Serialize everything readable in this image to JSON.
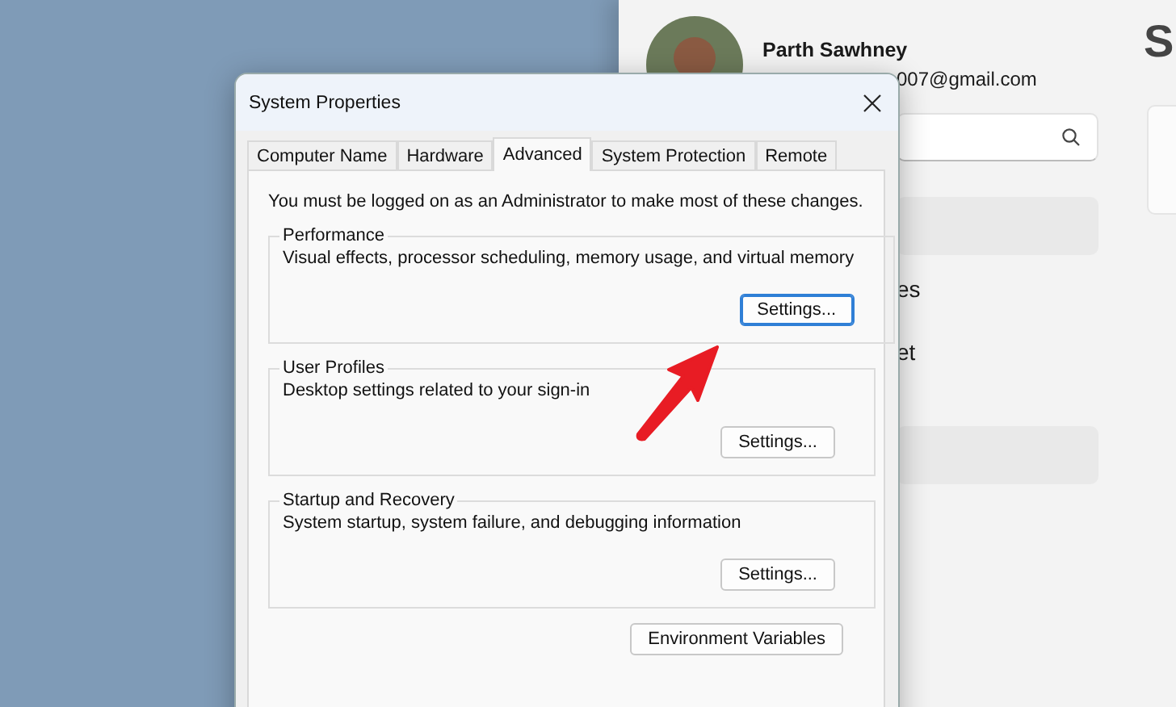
{
  "settings_window": {
    "profile": {
      "name": "Parth Sawhney",
      "email": "007@gmail.com"
    },
    "heading": "S",
    "nav_items": [
      {
        "label": "es"
      },
      {
        "label": "et"
      }
    ]
  },
  "dialog": {
    "title": "System Properties",
    "tabs": [
      {
        "label": "Computer Name",
        "selected": false
      },
      {
        "label": "Hardware",
        "selected": false
      },
      {
        "label": "Advanced",
        "selected": true
      },
      {
        "label": "System Protection",
        "selected": false
      },
      {
        "label": "Remote",
        "selected": false
      }
    ],
    "notice": "You must be logged on as an Administrator to make most of these changes.",
    "groups": [
      {
        "title": "Performance",
        "description": "Visual effects, processor scheduling, memory usage, and virtual memory",
        "button": "Settings...",
        "focused": true
      },
      {
        "title": "User Profiles",
        "description": "Desktop settings related to your sign-in",
        "button": "Settings...",
        "focused": false
      },
      {
        "title": "Startup and Recovery",
        "description": "System startup, system failure, and debugging information",
        "button": "Settings...",
        "focused": false
      }
    ],
    "bottom_button": "Environment Variables"
  }
}
